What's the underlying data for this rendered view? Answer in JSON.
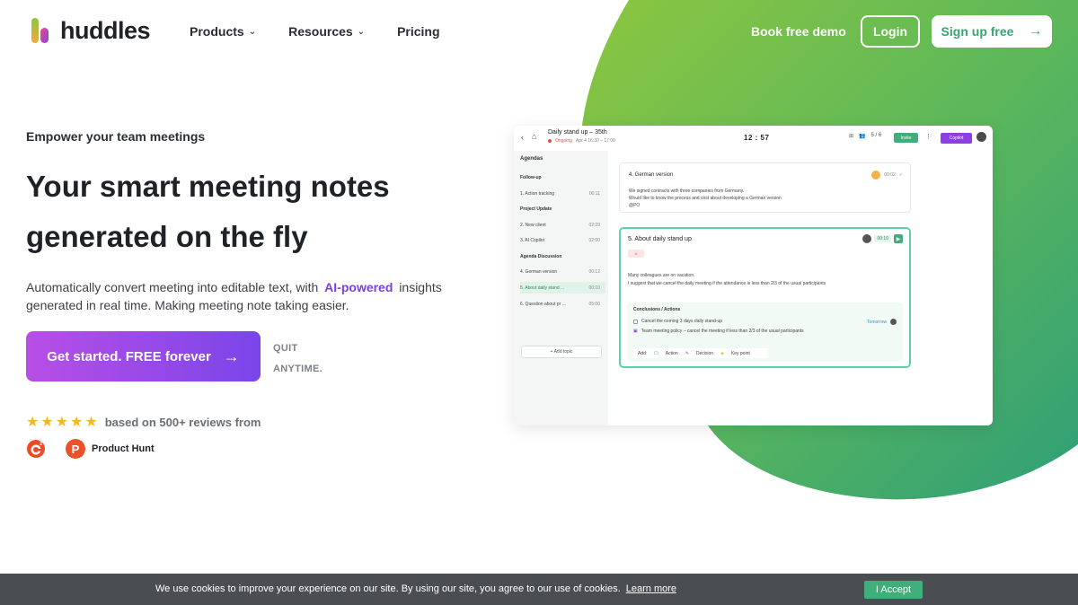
{
  "brand": {
    "name": "huddles"
  },
  "nav": {
    "items": [
      {
        "label": "Products",
        "has_dropdown": true
      },
      {
        "label": "Resources",
        "has_dropdown": true
      },
      {
        "label": "Pricing",
        "has_dropdown": false
      }
    ],
    "demo_label": "Book free demo",
    "login_label": "Login",
    "signup_label": "Sign up free"
  },
  "hero": {
    "kicker": "Empower your team meetings",
    "headline_line1": "Your smart meeting notes",
    "headline_line2": "generated on the fly",
    "sub_part1": "Automatically convert meeting into editable text, with",
    "sub_highlight": "AI-powered",
    "sub_part2": "insights generated in real time. Making meeting note taking easier.",
    "cta_label": "Get started. FREE forever",
    "quit_line1": "QUIT",
    "quit_line2": "ANYTIME.",
    "rating_stars": 5,
    "reviews_text": "based on 500+ reviews from",
    "review_source_ph": "Product Hunt"
  },
  "mockup": {
    "meeting_title": "Daily stand up – 35th",
    "status": "Ongoing",
    "date": "Apr 4 16:30 – 17:00",
    "timer": "12 : 57",
    "participants": "5 / 6",
    "invite_label": "Invite",
    "copilot_label": "Copilot",
    "sidebar": {
      "heading": "Agendas",
      "items": [
        {
          "label": "Follow-up",
          "time": "",
          "type": "group"
        },
        {
          "label": "1. Action tracking",
          "time": "00:11",
          "type": "item"
        },
        {
          "label": "Project Update",
          "time": "",
          "type": "group"
        },
        {
          "label": "2. New client",
          "time": "02:29",
          "type": "item"
        },
        {
          "label": "3. AI Copilot",
          "time": "02:00",
          "type": "item"
        },
        {
          "label": "Agenda Discussion",
          "time": "",
          "type": "group"
        },
        {
          "label": "4. German version",
          "time": "00:12",
          "type": "item"
        },
        {
          "label": "5. About daily stand ...",
          "time": "00:10",
          "type": "active"
        },
        {
          "label": "6. Question about pr ...",
          "time": "05:00",
          "type": "item"
        }
      ],
      "add_topic": "+ Add topic"
    },
    "card1": {
      "title": "4. German version",
      "body1": "We signed contracts with three companies from Germany.",
      "body2": "Would like to know the process and cost about developing a German version",
      "owner": "@PO",
      "time": "00:02"
    },
    "card2": {
      "title": "5. About daily stand up",
      "tag": "H",
      "time": "00:10",
      "body1": "Many colleagues are on vacation.",
      "body2": "I suggest that we cancel the daily meeting if the attendance is less than 2/3 of the usual participants",
      "conclusions_head": "Conclusions / Actions",
      "action1": "Cancel the coming 3 days daily stand-up",
      "action1_due": "Tomorrow",
      "action2": "Team meeting policy – cancel the meeting if less than 2/3 of the usual participants",
      "add_label": "Add:",
      "add_action": "Action",
      "add_decision": "Decision",
      "add_keypoint": "Key point"
    }
  },
  "cookie": {
    "text": "We use cookies to improve your experience on our site. By using our site, you agree to our use of cookies.",
    "link_label": "Learn more",
    "accept_label": "I Accept"
  },
  "colors": {
    "accent_green": "#3fae7a",
    "cta_purple_start": "#b84ee6",
    "cta_purple_end": "#7a45ea",
    "ai_highlight": "#7b3fe4",
    "star": "#f6b626"
  }
}
